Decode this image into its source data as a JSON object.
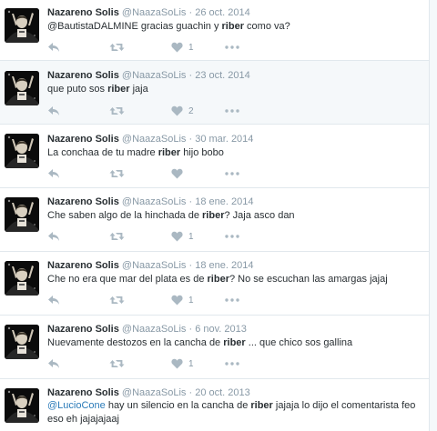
{
  "author": {
    "name": "Nazareno Solis",
    "handle": "@NaazaSoLis",
    "separator": "·"
  },
  "tweets": [
    {
      "date": "26 oct. 2014",
      "segments": [
        {
          "text": "@BautistaDALMINE gracias guachin y ",
          "style": "plain"
        },
        {
          "text": "riber",
          "style": "bold"
        },
        {
          "text": " como va?",
          "style": "plain"
        }
      ],
      "likes": "1",
      "highlighted": false
    },
    {
      "date": "23 oct. 2014",
      "segments": [
        {
          "text": "que puto sos ",
          "style": "plain"
        },
        {
          "text": "riber",
          "style": "bold"
        },
        {
          "text": " jaja",
          "style": "plain"
        }
      ],
      "likes": "2",
      "highlighted": true
    },
    {
      "date": "30 mar. 2014",
      "segments": [
        {
          "text": "La conchaa de tu madre ",
          "style": "plain"
        },
        {
          "text": "riber",
          "style": "bold"
        },
        {
          "text": " hijo bobo",
          "style": "plain"
        }
      ],
      "likes": "",
      "highlighted": false
    },
    {
      "date": "18 ene. 2014",
      "segments": [
        {
          "text": "Che saben algo de la hinchada de ",
          "style": "plain"
        },
        {
          "text": "riber",
          "style": "bold"
        },
        {
          "text": "? Jaja asco dan",
          "style": "plain"
        }
      ],
      "likes": "1",
      "highlighted": false
    },
    {
      "date": "18 ene. 2014",
      "segments": [
        {
          "text": "Che no era que mar del plata es de ",
          "style": "plain"
        },
        {
          "text": "riber",
          "style": "bold"
        },
        {
          "text": "? No se escuchan las amargas jajaj",
          "style": "plain"
        }
      ],
      "likes": "1",
      "highlighted": false
    },
    {
      "date": "6 nov. 2013",
      "segments": [
        {
          "text": "Nuevamente destozos en la cancha de ",
          "style": "plain"
        },
        {
          "text": "riber",
          "style": "bold"
        },
        {
          "text": " ... que chico sos gallina",
          "style": "plain"
        }
      ],
      "likes": "1",
      "highlighted": false
    },
    {
      "date": "20 oct. 2013",
      "segments": [
        {
          "text": "@LucioCone",
          "style": "mention"
        },
        {
          "text": " hay un silencio en la cancha de ",
          "style": "plain"
        },
        {
          "text": "riber",
          "style": "bold"
        },
        {
          "text": " jajaja lo dijo el comentarista feo eso eh jajajajaaj",
          "style": "plain"
        }
      ],
      "likes": "1",
      "highlighted": false
    }
  ],
  "icons": {
    "reply": "reply-icon",
    "retweet": "retweet-icon",
    "like": "heart-icon",
    "more": "more-icon",
    "avatar": "avatar"
  },
  "colors": {
    "icon": "#aab8c2",
    "meta": "#8899a6",
    "text": "#292f33",
    "mention": "#2b7bb9",
    "highlight_bg": "#f5f8fa",
    "divider": "#e1e8ed"
  }
}
